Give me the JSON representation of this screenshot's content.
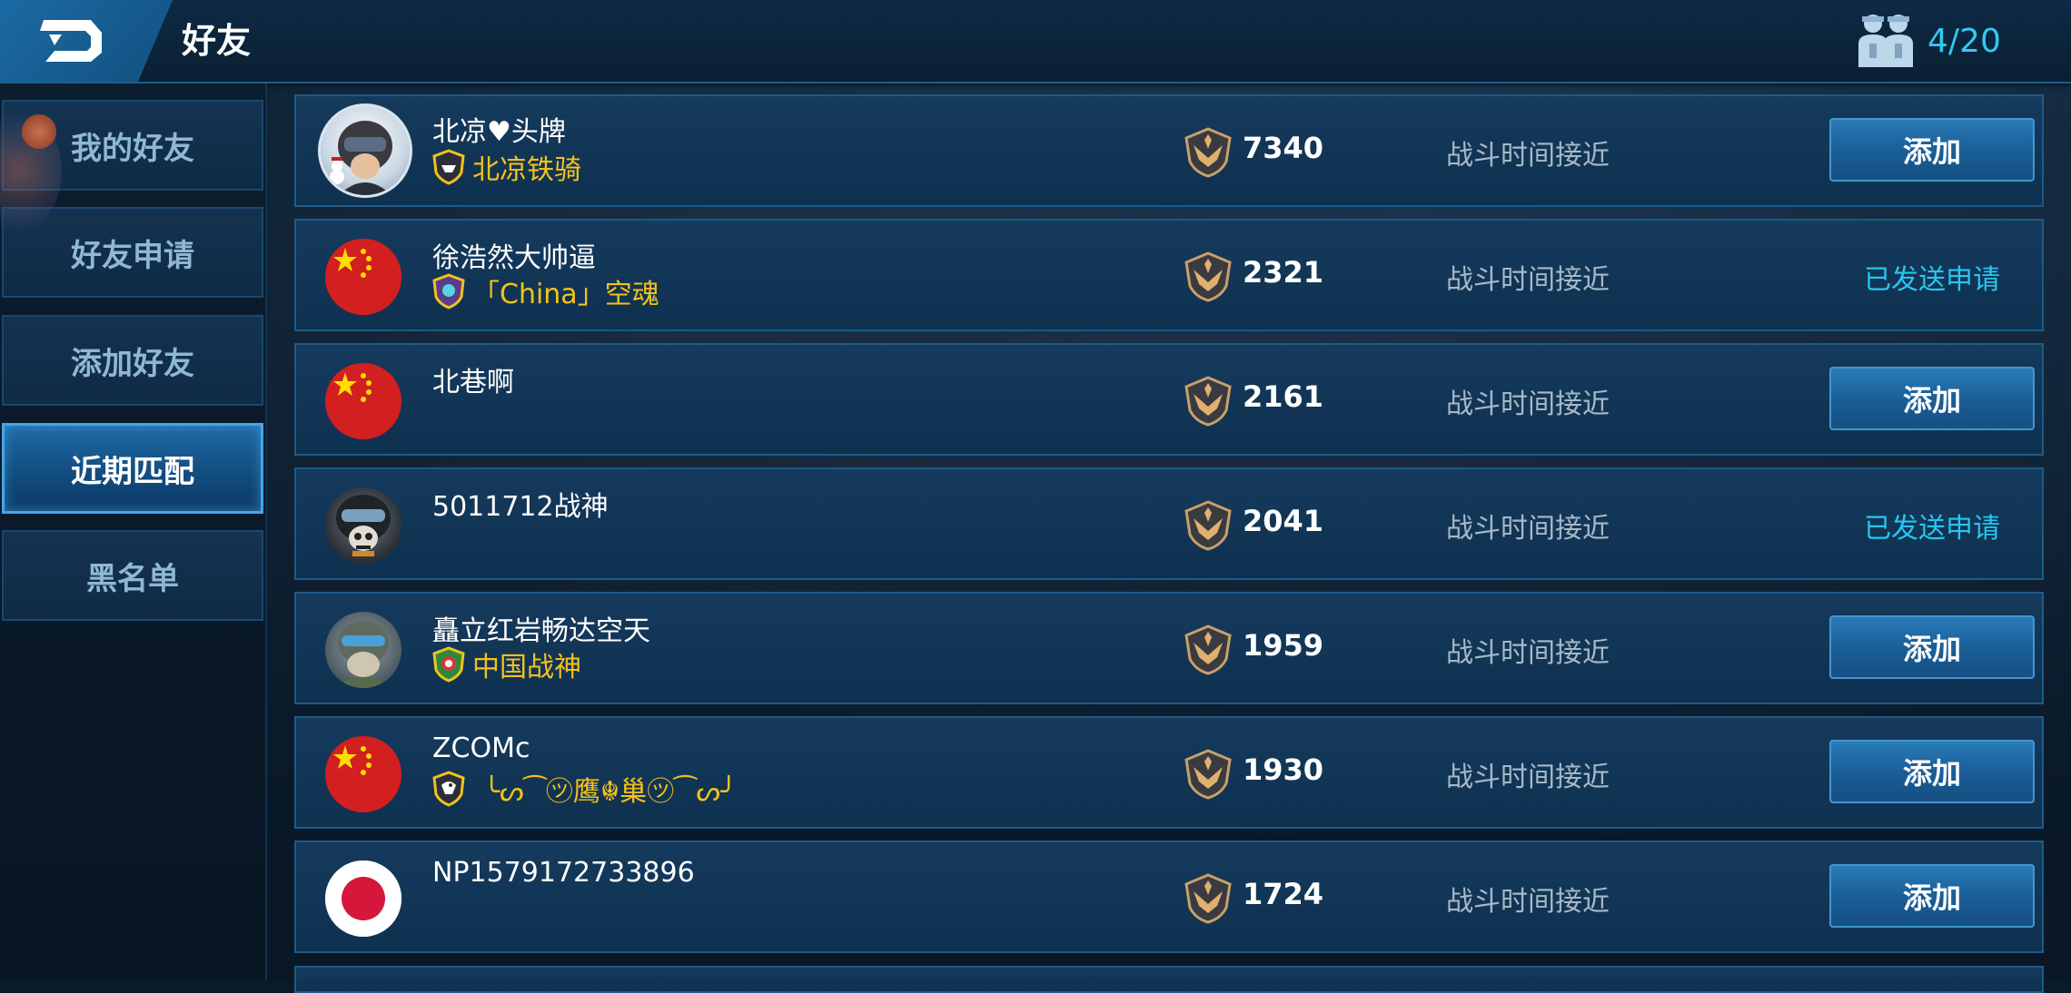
{
  "header": {
    "title": "好友",
    "friend_count": "4/20",
    "icon": "friends-icon"
  },
  "sidebar": {
    "tabs": [
      {
        "label": "我的好友",
        "active": false
      },
      {
        "label": "好友申请",
        "active": false
      },
      {
        "label": "添加好友",
        "active": false
      },
      {
        "label": "近期匹配",
        "active": true
      },
      {
        "label": "黑名单",
        "active": false
      }
    ]
  },
  "rows": [
    {
      "name": "北凉♥头牌",
      "tag": "北凉铁骑",
      "avatar": "pilot-avatar",
      "score": "7340",
      "status": "战斗时间接近",
      "action": "添加"
    },
    {
      "name": "徐浩然大帅逼",
      "tag": "「China」空魂",
      "avatar": "china-flag",
      "score": "2321",
      "status": "战斗时间接近",
      "action": "已发送申请"
    },
    {
      "name": "北巷啊",
      "tag": "",
      "avatar": "china-flag",
      "score": "2161",
      "status": "战斗时间接近",
      "action": "添加"
    },
    {
      "name": "5011712战神",
      "tag": "",
      "avatar": "skull-pilot-avatar",
      "score": "2041",
      "status": "战斗时间接近",
      "action": "已发送申请"
    },
    {
      "name": "矗立红岩畅达空天",
      "tag": "中国战神",
      "avatar": "pilot-avatar",
      "score": "1959",
      "status": "战斗时间接近",
      "action": "添加"
    },
    {
      "name": "ZCOMc",
      "tag": "╰ᔕ⁀㋡鹰☬巢㋡⁀ᔕ╯",
      "avatar": "china-flag",
      "score": "1930",
      "status": "战斗时间接近",
      "action": "添加"
    },
    {
      "name": "NP1579172733896",
      "tag": "",
      "avatar": "japan-flag",
      "score": "1724",
      "status": "战斗时间接近",
      "action": "添加"
    }
  ],
  "colors": {
    "accent": "#33c8f0",
    "tag_gold": "#f2c21b",
    "button_blue": "#1a5f98",
    "sent_cyan": "#28c6ee"
  }
}
